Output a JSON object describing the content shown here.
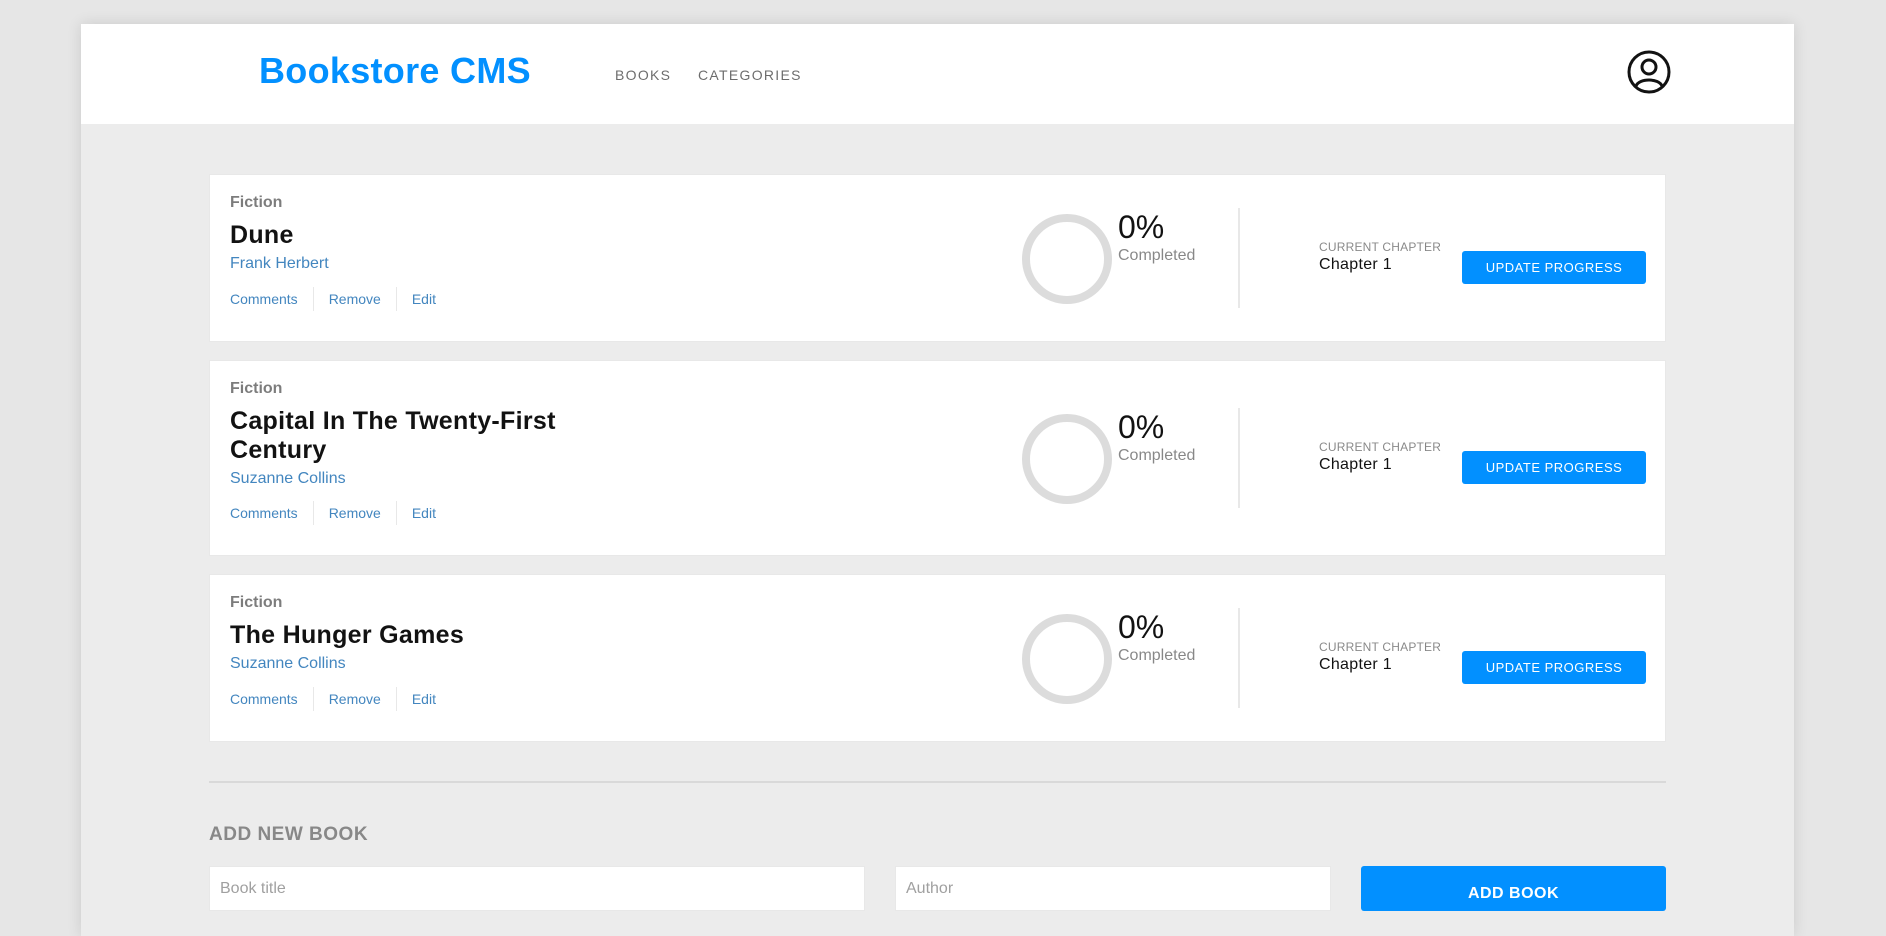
{
  "header": {
    "logo": "Bookstore CMS",
    "nav": [
      "BOOKS",
      "CATEGORIES"
    ],
    "user_icon": "user-circle-icon"
  },
  "books": [
    {
      "genre": "Fiction",
      "title": "Dune",
      "author": "Frank Herbert",
      "actions": [
        "Comments",
        "Remove",
        "Edit"
      ],
      "percent": "0%",
      "completed_label": "Completed",
      "current_chapter_label": "CURRENT CHAPTER",
      "current_chapter": "Chapter 1",
      "update_label": "UPDATE PROGRESS"
    },
    {
      "genre": "Fiction",
      "title": "Capital In The Twenty-First Century",
      "author": "Suzanne Collins",
      "actions": [
        "Comments",
        "Remove",
        "Edit"
      ],
      "percent": "0%",
      "completed_label": "Completed",
      "current_chapter_label": "CURRENT CHAPTER",
      "current_chapter": "Chapter 1",
      "update_label": "UPDATE PROGRESS"
    },
    {
      "genre": "Fiction",
      "title": "The Hunger Games",
      "author": "Suzanne Collins",
      "actions": [
        "Comments",
        "Remove",
        "Edit"
      ],
      "percent": "0%",
      "completed_label": "Completed",
      "current_chapter_label": "CURRENT CHAPTER",
      "current_chapter": "Chapter 1",
      "update_label": "UPDATE PROGRESS"
    }
  ],
  "add_form": {
    "title": "ADD NEW BOOK",
    "title_placeholder": "Book title",
    "author_placeholder": "Author",
    "submit_label": "ADD BOOK"
  },
  "colors": {
    "accent": "#0290ff",
    "author_link": "#4386bf",
    "background": "#ececec"
  }
}
